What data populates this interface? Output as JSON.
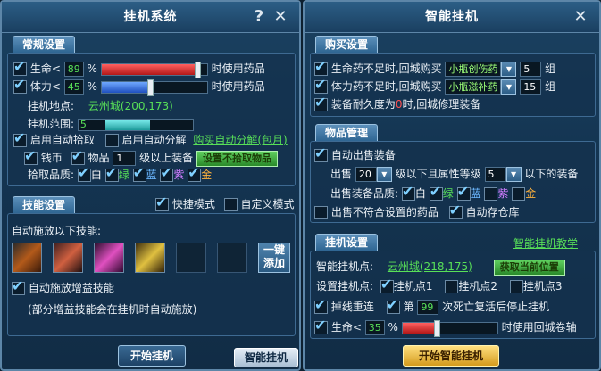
{
  "left": {
    "title": "挂机系统",
    "help_icon": "question-icon",
    "close_icon": "sword-close-icon",
    "normal": {
      "tab": "常规设置",
      "hp": {
        "label": "生命<",
        "value": "89",
        "unit": "%",
        "after": "时使用药品",
        "level": 0.89
      },
      "mp": {
        "label": "体力<",
        "value": "45",
        "unit": "%",
        "after": "时使用药品",
        "level": 0.45
      },
      "location_label": "挂机地点:",
      "location_value": "云州城(200,173)",
      "range_label": "挂机范围:",
      "range_value": "5",
      "range_level": 0.5,
      "auto_pick": "启用自动拾取",
      "auto_decompose": "启用自动分解",
      "buy_decompose": "购买自动分解(包月)",
      "coin": "钱币",
      "item": "物品",
      "item_level": "1",
      "item_level_suffix": "级以上装备",
      "set_ignore": "设置不拾取物品",
      "pick_quality": "拾取品质:",
      "q_white": "白",
      "q_green": "绿",
      "q_blue": "蓝",
      "q_purple": "紫",
      "q_gold": "金"
    },
    "skills": {
      "tab": "技能设置",
      "fast_mode": "快捷模式",
      "custom_mode": "自定义模式",
      "auto_release_label": "自动施放以下技能:",
      "add_button": "一键添加",
      "auto_buff": "自动施放增益技能",
      "note": "(部分增益技能会在挂机时自动施放)"
    },
    "start_button": "开始挂机",
    "smart_button": "智能挂机"
  },
  "right": {
    "title": "智能挂机",
    "close_icon": "sword-close-icon",
    "buy": {
      "tab": "购买设置",
      "hp_pot_prefix": "生命药不足时,回城购买",
      "hp_pot_name": "小瓶创伤药",
      "hp_pot_count": "5",
      "hp_pot_unit": "组",
      "mp_pot_prefix": "体力药不足时,回城购买",
      "mp_pot_name": "小瓶滋补药",
      "mp_pot_count": "15",
      "mp_pot_unit": "组",
      "repair_prefix": "装备耐久度为",
      "repair_value": "0",
      "repair_suffix": "时,回城修理装备"
    },
    "items": {
      "tab": "物品管理",
      "auto_sell": "自动出售装备",
      "sell_label": "出售",
      "sell_level": "20",
      "sell_mid": "级以下且属性等级",
      "sell_attr": "5",
      "sell_suffix": "以下的装备",
      "sell_quality": "出售装备品质:",
      "q_white": "白",
      "q_green": "绿",
      "q_blue": "蓝",
      "q_purple": "紫",
      "q_gold": "金",
      "sell_unmatched": "出售不符合设置的药品",
      "auto_store": "自动存仓库"
    },
    "afk": {
      "tab": "挂机设置",
      "tutorial": "智能挂机教学",
      "point_label": "智能挂机点:",
      "point_value": "云州城(218,175)",
      "get_pos": "获取当前位置",
      "set_point_label": "设置挂机点:",
      "p1": "挂机点1",
      "p2": "挂机点2",
      "p3": "挂机点3",
      "reconnect": "掉线重连",
      "death_prefix": "第",
      "death_value": "99",
      "death_suffix": "次死亡复活后停止挂机",
      "hp_label": "生命<",
      "hp_value": "35",
      "hp_unit": "%",
      "hp_after": "时使用回城卷轴",
      "hp_level": 0.35
    },
    "start_button": "开始智能挂机"
  }
}
